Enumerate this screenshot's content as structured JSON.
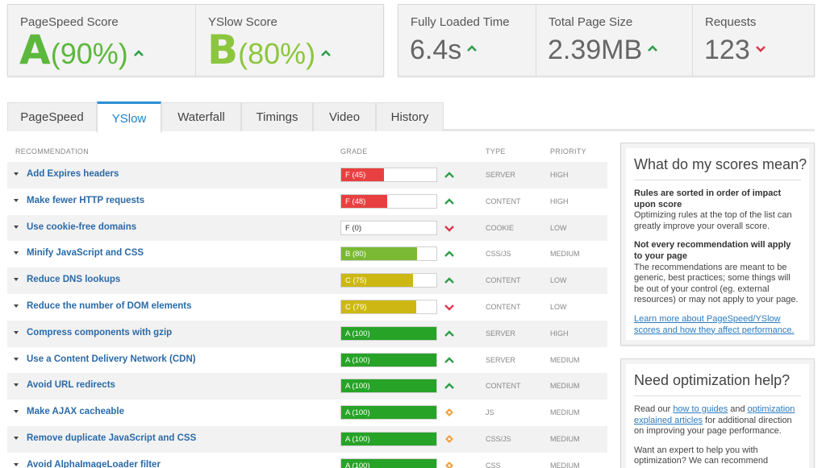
{
  "scores": {
    "pagespeed": {
      "label": "PageSpeed Score",
      "grade": "A",
      "percent": "(90%)",
      "color": "#5cb83c"
    },
    "yslow": {
      "label": "YSlow Score",
      "grade": "B",
      "percent": "(80%)",
      "color": "#8cc63f"
    }
  },
  "metrics": {
    "fully_loaded": {
      "label": "Fully Loaded Time",
      "value": "6.4s",
      "trend": "up"
    },
    "page_size": {
      "label": "Total Page Size",
      "value": "2.39MB",
      "trend": "up"
    },
    "requests": {
      "label": "Requests",
      "value": "123",
      "trend": "down"
    }
  },
  "tabs": [
    {
      "label": "PageSpeed",
      "active": false
    },
    {
      "label": "YSlow",
      "active": true
    },
    {
      "label": "Waterfall",
      "active": false
    },
    {
      "label": "Timings",
      "active": false
    },
    {
      "label": "Video",
      "active": false
    },
    {
      "label": "History",
      "active": false
    }
  ],
  "table": {
    "headers": {
      "recommendation": "RECOMMENDATION",
      "grade": "GRADE",
      "type": "TYPE",
      "priority": "PRIORITY"
    },
    "rows": [
      {
        "name": "Add Expires headers",
        "grade": "F (45)",
        "score": 45,
        "color": "#e84040",
        "trend": "up",
        "type": "SERVER",
        "priority": "HIGH"
      },
      {
        "name": "Make fewer HTTP requests",
        "grade": "F (48)",
        "score": 48,
        "color": "#e84040",
        "trend": "up",
        "type": "CONTENT",
        "priority": "HIGH"
      },
      {
        "name": "Use cookie-free domains",
        "grade": "F (0)",
        "score": 0,
        "color": "#e84040",
        "trend": "down",
        "type": "COOKIE",
        "priority": "LOW"
      },
      {
        "name": "Minify JavaScript and CSS",
        "grade": "B (80)",
        "score": 80,
        "color": "#79b933",
        "trend": "up",
        "type": "CSS/JS",
        "priority": "MEDIUM"
      },
      {
        "name": "Reduce DNS lookups",
        "grade": "C (75)",
        "score": 75,
        "color": "#cdb813",
        "trend": "up",
        "type": "CONTENT",
        "priority": "LOW"
      },
      {
        "name": "Reduce the number of DOM elements",
        "grade": "C (79)",
        "score": 79,
        "color": "#cdb813",
        "trend": "down",
        "type": "CONTENT",
        "priority": "LOW"
      },
      {
        "name": "Compress components with gzip",
        "grade": "A (100)",
        "score": 100,
        "color": "#27a327",
        "trend": "up",
        "type": "SERVER",
        "priority": "HIGH"
      },
      {
        "name": "Use a Content Delivery Network (CDN)",
        "grade": "A (100)",
        "score": 100,
        "color": "#27a327",
        "trend": "up",
        "type": "SERVER",
        "priority": "MEDIUM"
      },
      {
        "name": "Avoid URL redirects",
        "grade": "A (100)",
        "score": 100,
        "color": "#27a327",
        "trend": "up",
        "type": "CONTENT",
        "priority": "MEDIUM"
      },
      {
        "name": "Make AJAX cacheable",
        "grade": "A (100)",
        "score": 100,
        "color": "#27a327",
        "trend": "neutral",
        "type": "JS",
        "priority": "MEDIUM"
      },
      {
        "name": "Remove duplicate JavaScript and CSS",
        "grade": "A (100)",
        "score": 100,
        "color": "#27a327",
        "trend": "neutral",
        "type": "CSS/JS",
        "priority": "MEDIUM"
      },
      {
        "name": "Avoid AlphaImageLoader filter",
        "grade": "A (100)",
        "score": 100,
        "color": "#27a327",
        "trend": "neutral",
        "type": "CSS",
        "priority": "MEDIUM"
      }
    ]
  },
  "sidebar": {
    "scores_box": {
      "title": "What do my scores mean?",
      "h1": "Rules are sorted in order of impact upon score",
      "p1": "Optimizing rules at the top of the list can greatly improve your overall score.",
      "h2": "Not every recommendation will apply to your page",
      "p2": "The recommendations are meant to be generic, best practices; some things will be out of your control (eg. external resources) or may not apply to your page.",
      "link": "Learn more about PageSpeed/YSlow scores and how they affect performance."
    },
    "help_box": {
      "title": "Need optimization help?",
      "t1": "Read our ",
      "link1": "how to guides",
      "t2": " and ",
      "link2": "optimization explained articles",
      "t3": " for additional direction on improving your page performance.",
      "p2": "Want an expert to help you with optimization? We can recommend partners to further assist you with"
    }
  },
  "colors": {
    "up": "#2e9e4a",
    "down": "#e0364f",
    "neutral": "#f0a040",
    "accent": "#2d8fd5"
  }
}
